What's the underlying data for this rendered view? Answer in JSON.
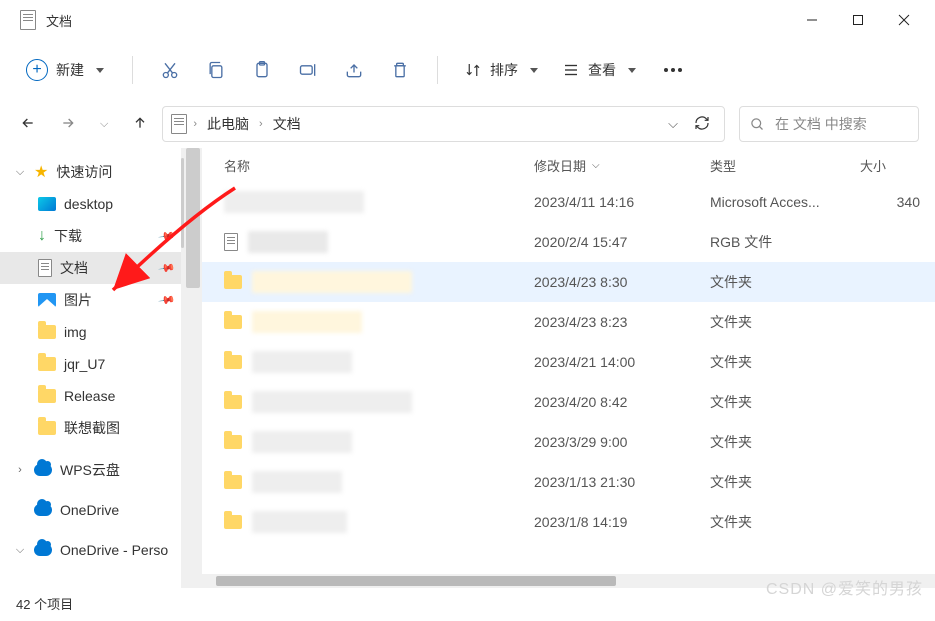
{
  "window": {
    "title": "文档"
  },
  "toolbar": {
    "new_label": "新建",
    "sort_label": "排序",
    "view_label": "查看"
  },
  "breadcrumb": {
    "root": "此电脑",
    "current": "文档"
  },
  "search": {
    "placeholder": "在 文档 中搜索"
  },
  "sidebar": {
    "quick_access": "快速访问",
    "items": [
      {
        "label": "desktop"
      },
      {
        "label": "下载"
      },
      {
        "label": "文档"
      },
      {
        "label": "图片"
      },
      {
        "label": "img"
      },
      {
        "label": "jqr_U7"
      },
      {
        "label": "Release"
      },
      {
        "label": "联想截图"
      }
    ],
    "wps": "WPS云盘",
    "onedrive": "OneDrive",
    "onedrive_personal": "OneDrive - Perso"
  },
  "columns": {
    "name": "名称",
    "date": "修改日期",
    "type": "类型",
    "size": "大小"
  },
  "rows": [
    {
      "date": "2023/4/11 14:16",
      "type": "Microsoft Acces...",
      "size": "340"
    },
    {
      "date": "2020/2/4 15:47",
      "type": "RGB 文件",
      "size": ""
    },
    {
      "date": "2023/4/23 8:30",
      "type": "文件夹",
      "size": ""
    },
    {
      "date": "2023/4/23 8:23",
      "type": "文件夹",
      "size": ""
    },
    {
      "date": "2023/4/21 14:00",
      "type": "文件夹",
      "size": ""
    },
    {
      "date": "2023/4/20 8:42",
      "type": "文件夹",
      "size": ""
    },
    {
      "date": "2023/3/29 9:00",
      "type": "文件夹",
      "size": ""
    },
    {
      "date": "2023/1/13 21:30",
      "type": "文件夹",
      "size": ""
    },
    {
      "date": "2023/1/8 14:19",
      "type": "文件夹",
      "size": ""
    }
  ],
  "status": {
    "count": "42 个项目"
  },
  "watermark": "CSDN @爱笑的男孩"
}
